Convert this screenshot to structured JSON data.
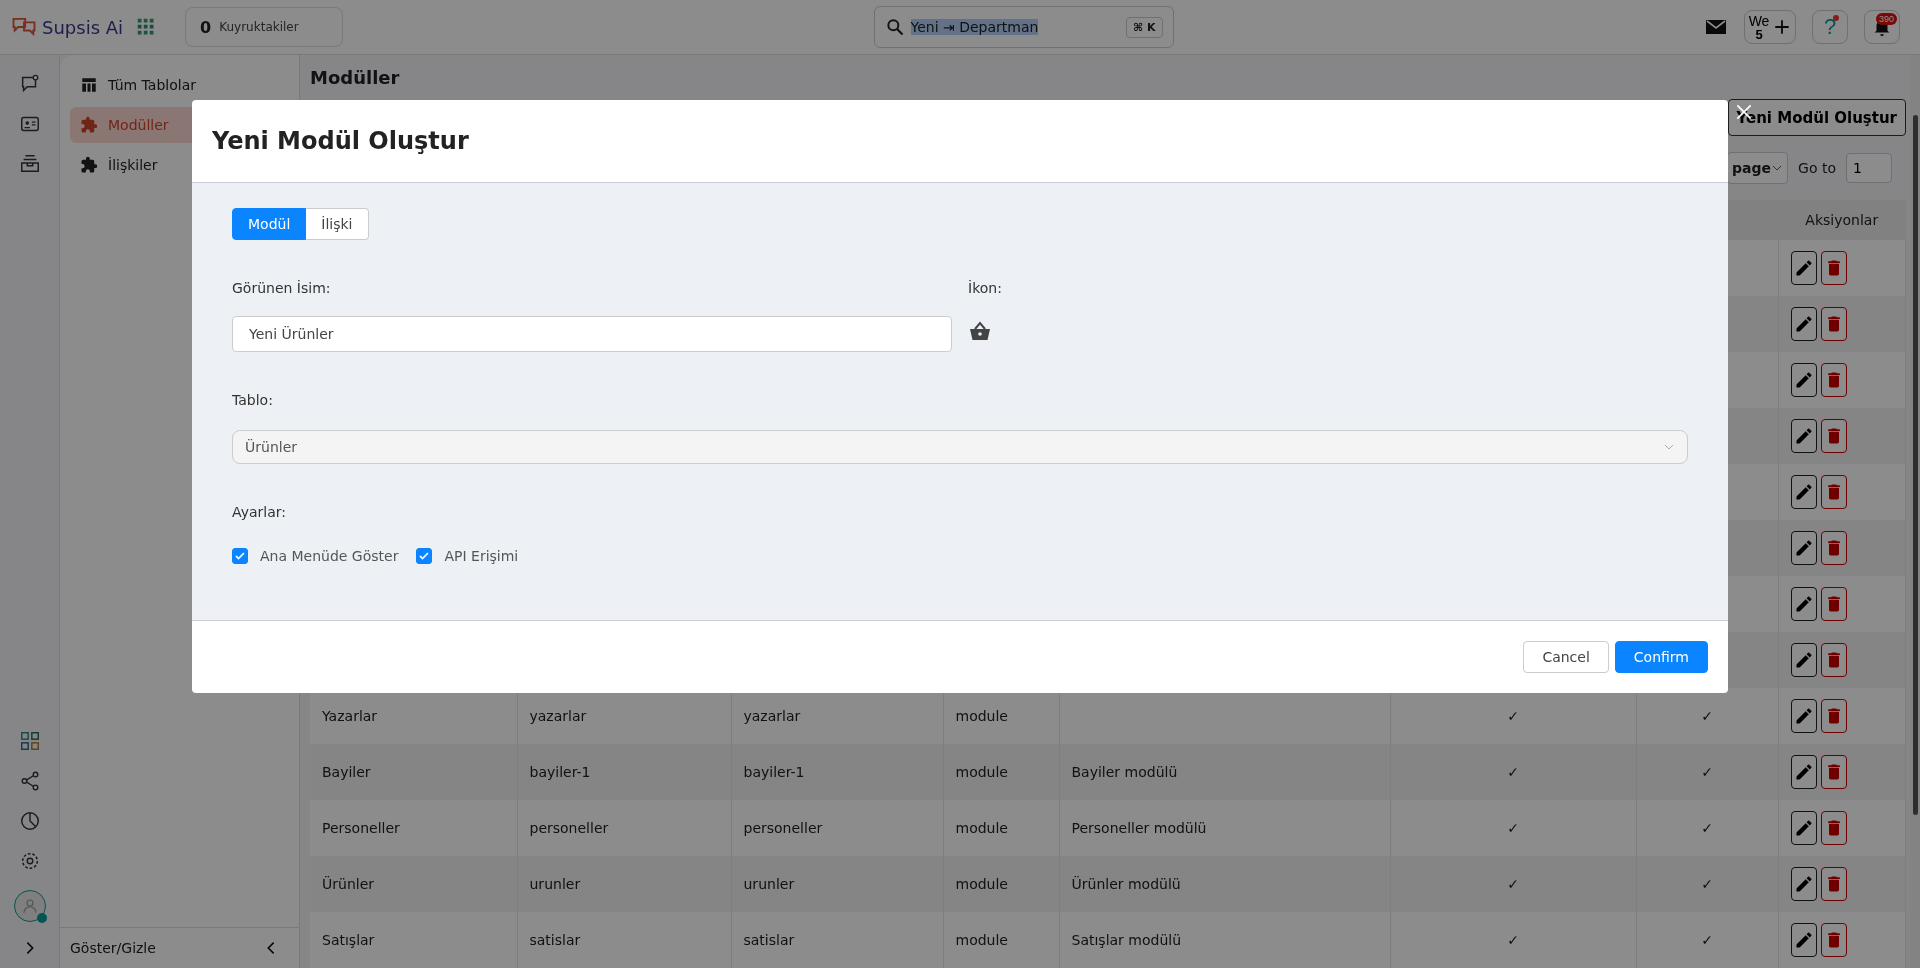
{
  "topbar": {
    "brand": "Supsis Ai",
    "queue_count": "0",
    "queue_label": "Kuyruktakiler",
    "search_text": "Yeni ⇥ Departman",
    "search_shortcut": "⌘ K",
    "workspace_label": "We",
    "workspace_count": "5",
    "help_label": "?",
    "notification_count": "390"
  },
  "sidebar": {
    "items": [
      {
        "label": "Tüm Tablolar",
        "selected": false,
        "kind": "table"
      },
      {
        "label": "Modüller",
        "selected": true,
        "kind": "puzzle"
      },
      {
        "label": "İlişkiler",
        "selected": false,
        "kind": "puzzle"
      }
    ],
    "toggle_label": "Göster/Gizle"
  },
  "page": {
    "title": "Modüller",
    "create_button": "Yeni Modül Oluştur",
    "page_size_label": "page",
    "go_to_label": "Go to",
    "go_to_value": "1"
  },
  "table": {
    "actions_heading": "Aksiyonlar",
    "rows": [
      {
        "kind": "covered"
      },
      {
        "kind": "covered"
      },
      {
        "kind": "covered"
      },
      {
        "kind": "covered"
      },
      {
        "kind": "covered"
      },
      {
        "kind": "covered"
      },
      {
        "kind": "covered"
      },
      {
        "kind": "covered"
      },
      {
        "kind": "row",
        "column_1": "Yazarlar",
        "column_2": "yazarlar",
        "column_3": "yazarlar",
        "column_4": "module",
        "column_6": "✓",
        "column_7": "✓"
      },
      {
        "kind": "row",
        "column_1": "Bayiler",
        "column_2": "bayiler-1",
        "column_3": "bayiler-1",
        "column_4": "module",
        "column_5": "Bayiler modülü",
        "column_6": "✓",
        "column_7": "✓"
      },
      {
        "kind": "row",
        "column_1": "Personeller",
        "column_2": "personeller",
        "column_3": "personeller",
        "column_4": "module",
        "column_5": "Personeller modülü",
        "column_6": "✓",
        "column_7": "✓"
      },
      {
        "kind": "row",
        "column_1": "Ürünler",
        "column_2": "urunler",
        "column_3": "urunler",
        "column_4": "module",
        "column_5": "Ürünler modülü",
        "column_6": "✓",
        "column_7": "✓"
      },
      {
        "kind": "row",
        "column_1": "Satışlar",
        "column_2": "satislar",
        "column_3": "satislar",
        "column_4": "module",
        "column_5": "Satışlar modülü",
        "column_6": "✓",
        "column_7": "✓"
      }
    ]
  },
  "modal": {
    "title": "Yeni Modül Oluştur",
    "tabs": [
      {
        "label": "Modül",
        "selected": true
      },
      {
        "label": "İlişki",
        "selected": false
      }
    ],
    "display_name_label": "Görünen İsim:",
    "display_name_value": "Yeni Ürünler",
    "icon_label": "İkon:",
    "table_label": "Tablo:",
    "table_value": "Ürünler",
    "settings_label": "Ayarlar:",
    "settings": [
      {
        "label": "Ana Menüde Göster",
        "checked": true
      },
      {
        "label": "API Erişimi",
        "checked": true
      }
    ],
    "cancel": "Cancel",
    "confirm": "Confirm"
  }
}
